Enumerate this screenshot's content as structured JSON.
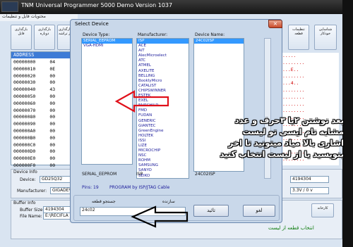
{
  "app": {
    "title": "TNM  Universal Programmer 5000 Demo   Version 1037",
    "menu": "محتویات فایل و تنظیمات",
    "toolbar": [
      {
        "label": "بارگذاری فایل"
      },
      {
        "label": "بارگذاری دوباره"
      },
      {
        "label": "بارگذاری از تراشه"
      }
    ],
    "toolbar_right": [
      {
        "label": "تنظیمات قطعه"
      },
      {
        "label": "شناسایی خودکار"
      }
    ],
    "hex_header": "ADDRESS",
    "hex_rows": [
      "00000000",
      "00000010",
      "00000020",
      "00000030",
      "00000040",
      "00000050",
      "00000060",
      "00000070",
      "00000080",
      "00000090",
      "000000A0",
      "000000B0",
      "000000C0",
      "000000D0",
      "000000E0",
      "000000F0"
    ],
    "hex_col2": [
      "04",
      "0E",
      "00",
      "00",
      "43",
      "00",
      "00",
      "00",
      "00",
      "00",
      "00",
      "00",
      "00",
      "00",
      "00",
      "00"
    ],
    "right_grid": [
      ".....",
      "........",
      "...E..",
      "........",
      "...4..",
      "........",
      "........",
      "........",
      "........",
      "........",
      "........",
      "........",
      "........",
      "........",
      "........",
      "........"
    ],
    "device_info": {
      "group": "Device Info",
      "device_label": "Device:",
      "device_value": "GD25Q32",
      "manufacturer_label": "Manufacturer:",
      "manufacturer_value": "GIGADEV",
      "size_value": "4194304",
      "voltage": "3.3V / 0 v"
    },
    "buffer_info": {
      "group": "Buffer Info",
      "size_label": "Buffer Size:",
      "size_value": "4194304",
      "file_label": "File Name:",
      "file_value": "E:\\RECIFLA"
    },
    "auto_button": "کارخانه",
    "footnote": "انتخاب قطعه از لیست"
  },
  "dialog": {
    "title": "Select Device",
    "close": "×",
    "col_device_type": "Device Type:",
    "col_manufacturer": "Manufacturer:",
    "col_device_name": "Device Name:",
    "device_types": [
      {
        "name": "SERIAL_EEPROM",
        "selected": true
      },
      {
        "name": "VGA-HDMI",
        "selected": false
      }
    ],
    "manufacturers": [
      {
        "name": "ISP",
        "selected": true
      },
      {
        "name": "ACE"
      },
      {
        "name": "AiT"
      },
      {
        "name": "AlecMicroelect"
      },
      {
        "name": "ATC"
      },
      {
        "name": "ATMEL"
      },
      {
        "name": "AXELITE"
      },
      {
        "name": "BELLING"
      },
      {
        "name": "BookIyMicro"
      },
      {
        "name": "CATALIST"
      },
      {
        "name": "CHIPSWINNER"
      },
      {
        "name": "ESTEK"
      },
      {
        "name": "EXEL"
      },
      {
        "name": "FAIRCHILD"
      },
      {
        "name": "FMD"
      },
      {
        "name": "FUDAN"
      },
      {
        "name": "GENERIC"
      },
      {
        "name": "GIANTEC"
      },
      {
        "name": "GreenEngine"
      },
      {
        "name": "HOLTEK"
      },
      {
        "name": "ISSI"
      },
      {
        "name": "LIZE"
      },
      {
        "name": "MICROCHIP"
      },
      {
        "name": "NSC"
      },
      {
        "name": "ROHM"
      },
      {
        "name": "SAMSUNG"
      },
      {
        "name": "SANYO"
      },
      {
        "name": "SEIKO"
      }
    ],
    "device_names": [
      {
        "name": "24C02ISP",
        "selected": true
      }
    ],
    "status_type": "SERIAL_EEPROM",
    "status_mfr": "ISP",
    "status_name": "24C02ISP",
    "status_pins": "Pins: 19",
    "status_note": "PROGRAM by ISP/JTAG Cable",
    "search_label": "جستجو قطعه",
    "search_value": "24c02",
    "filter_label": "سازنده",
    "ok_label": "تائید",
    "cancel_label": "لغو"
  },
  "annotation": {
    "line1": "بعد نوشتن ۲یا ۳حرف و عدد",
    "line2": "مشابه نام ایسی تو لیست",
    "line3": "اشاری بالا میاد میتونید تا اخر",
    "line4": "بنویسید یا از لیست انتخاب کنید",
    "arrow_color": "#ff0000"
  }
}
